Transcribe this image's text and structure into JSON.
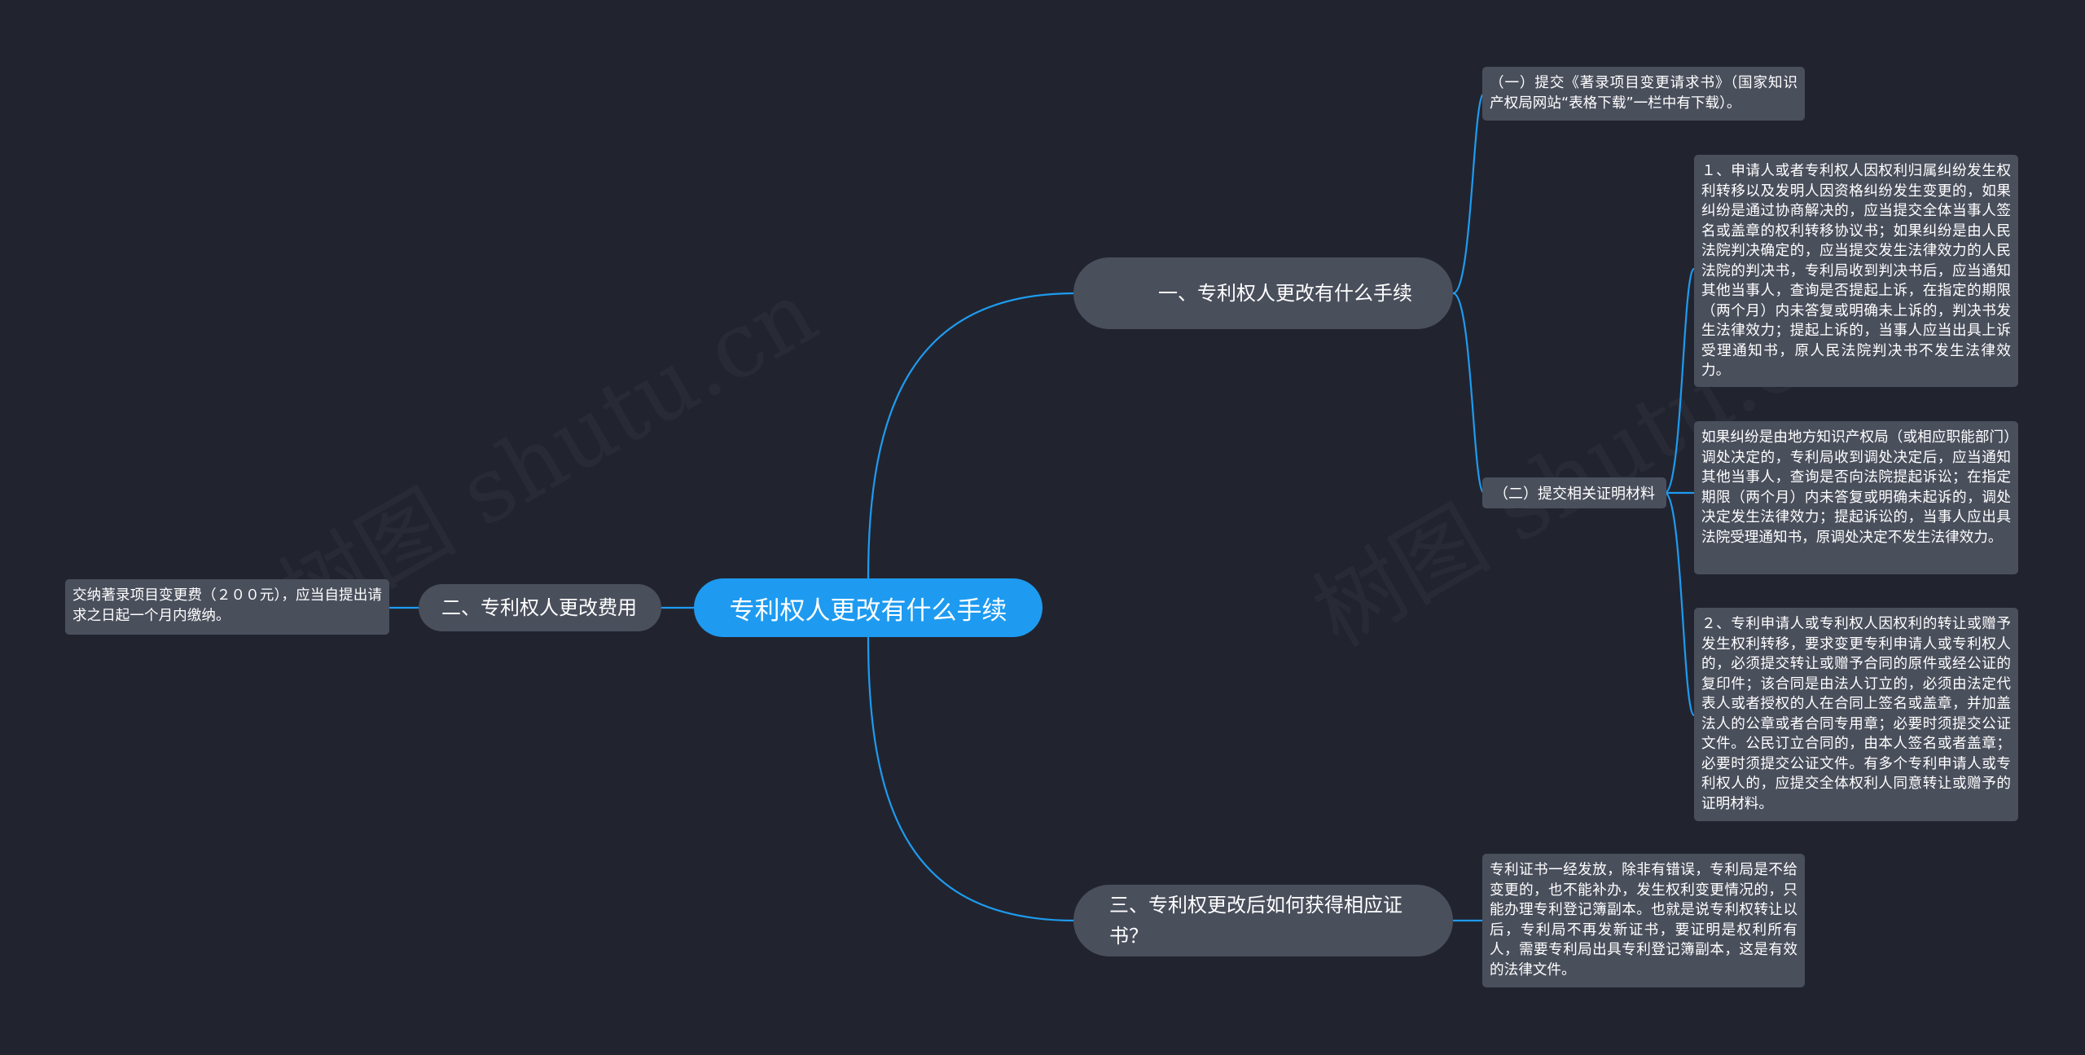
{
  "watermark": "树图 shutu.cn",
  "link_color": "#1e9bf0",
  "root": {
    "label": "专利权人更改有什么手续"
  },
  "branch1": {
    "label": "一、专利权人更改有什么手续",
    "sub1": {
      "text": "（一）提交《著录项目变更请求书》（国家知识产权局网站“表格下载”一栏中有下载）。"
    },
    "sub2": {
      "label": "（二）提交相关证明材料",
      "items": [
        {
          "text": "１、申请人或者专利权人因权利归属纠纷发生权利转移以及发明人因资格纠纷发生变更的，如果纠纷是通过协商解决的，应当提交全体当事人签名或盖章的权利转移协议书；如果纠纷是由人民法院判决确定的，应当提交发生法律效力的人民法院的判决书，专利局收到判决书后，应当通知其他当事人，查询是否提起上诉，在指定的期限（两个月）内未答复或明确未上诉的，判决书发生法律效力；提起上诉的，当事人应当出具上诉受理通知书，原人民法院判决书不发生法律效力。"
        },
        {
          "text": "如果纠纷是由地方知识产权局（或相应职能部门）调处决定的，专利局收到调处决定后，应当通知其他当事人，查询是否向法院提起诉讼；在指定期限（两个月）内未答复或明确未起诉的，调处决定发生法律效力；提起诉讼的，当事人应出具法院受理通知书，原调处决定不发生法律效力。"
        },
        {
          "text": "２、专利申请人或专利权人因权利的转让或赠予发生权利转移，要求变更专利申请人或专利权人的，必须提交转让或赠予合同的原件或经公证的复印件；该合同是由法人订立的，必须由法定代表人或者授权的人在合同上签名或盖章，并加盖法人的公章或者合同专用章；必要时须提交公证文件。公民订立合同的，由本人签名或者盖章；必要时须提交公证文件。有多个专利申请人或专利权人的，应提交全体权利人同意转让或赠予的证明材料。"
        }
      ]
    }
  },
  "branch2": {
    "label": "二、专利权人更改费用",
    "leaf": {
      "text": "交纳著录项目变更费（２００元），应当自提出请求之日起一个月内缴纳。"
    }
  },
  "branch3": {
    "label": "三、专利权更改后如何获得相应证书？",
    "leaf": {
      "text": "专利证书一经发放，除非有错误，专利局是不给变更的，也不能补办，发生权利变更情况的，只能办理专利登记簿副本。也就是说专利权转让以后，专利局不再发新证书，要证明是权利所有人，需要专利局出具专利登记簿副本，这是有效的法律文件。"
    }
  }
}
